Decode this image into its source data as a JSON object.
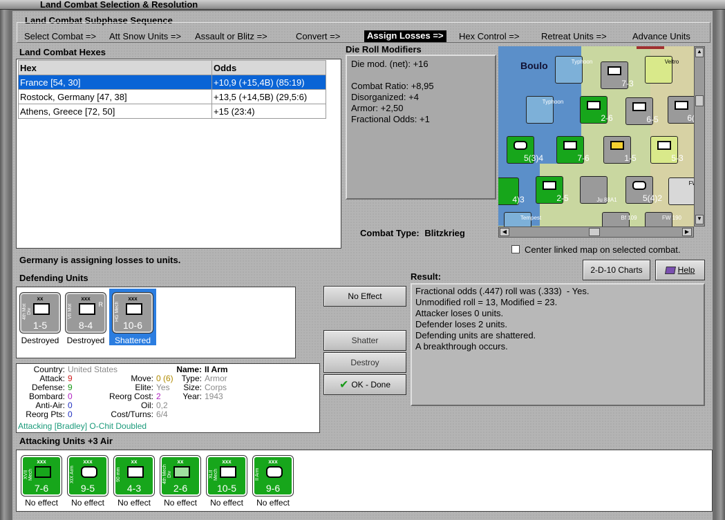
{
  "window": {
    "title": "Land Combat Selection & Resolution"
  },
  "subphase": {
    "heading": "Land Combat Subphase Sequence",
    "steps": [
      {
        "label": "Select Combat =>",
        "active": false
      },
      {
        "label": "Att Snow Units =>",
        "active": false
      },
      {
        "label": "Assault or Blitz =>",
        "active": false
      },
      {
        "label": "Convert =>",
        "active": false
      },
      {
        "label": "Assign Losses =>",
        "active": true
      },
      {
        "label": "Hex Control =>",
        "active": false
      },
      {
        "label": "Retreat Units =>",
        "active": false
      },
      {
        "label": "Advance Units",
        "active": false
      }
    ]
  },
  "hexes": {
    "heading": "Land Combat Hexes",
    "columns": [
      "Hex",
      "Odds"
    ],
    "rows": [
      {
        "hex": "France [54, 30]",
        "odds": "+10,9 (+15,4B) (85:19)",
        "selected": true
      },
      {
        "hex": "Rostock, Germany [47, 38]",
        "odds": "+13,5 (+14,5B) (29,5:6)",
        "selected": false
      },
      {
        "hex": "Athens, Greece [72, 50]",
        "odds": "+15 (23:4)",
        "selected": false
      }
    ]
  },
  "modifiers": {
    "heading": "Die Roll Modifiers",
    "lines": [
      "Die mod. (net): +16",
      "",
      "Combat Ratio: +8,95",
      "Disorganized: +4",
      "Armor: +2,50",
      "Fractional Odds: +1"
    ]
  },
  "combat_type": {
    "label": "Combat Type:",
    "value": "Blitzkrieg"
  },
  "center_map": {
    "label": "Center linked map on selected combat.",
    "checked": false
  },
  "status": "Germany is assigning losses to units.",
  "buttons": {
    "charts": "2-D-10 Charts",
    "help": "Help",
    "no_effect": "No Effect",
    "shatter": "Shatter",
    "destroy": "Destroy",
    "ok_done": "OK - Done"
  },
  "defending": {
    "heading": "Defending Units",
    "units": [
      {
        "side": "4th Mot Div",
        "size": "xx",
        "value": "1-5",
        "status": "Destroyed",
        "selected": false
      },
      {
        "side": "VII Mot",
        "size": "xxx",
        "value": "8-4",
        "status": "Destroyed",
        "selected": false,
        "flag": "R"
      },
      {
        "side": "HG Mech",
        "size": "xxx",
        "value": "10-6",
        "status": "Shattered",
        "selected": true
      }
    ]
  },
  "result": {
    "heading": "Result:",
    "lines": [
      "Fractional odds (.447) roll was (.333)  - Yes.",
      "Unmodified roll = 13, Modified = 23.",
      "Attacker loses 0 units.",
      "Defender loses 2 units.",
      "Defending units are shattered.",
      "A breakthrough occurs."
    ]
  },
  "unit_info": {
    "country_label": "Country:",
    "country": "United States",
    "attack_label": "Attack:",
    "attack": "9",
    "defense_label": "Defense:",
    "defense": "9",
    "bombard_label": "Bombard:",
    "bombard": "0",
    "antiair_label": "Anti-Air:",
    "antiair": "0",
    "reorgpts_label": "Reorg Pts:",
    "reorgpts": "0",
    "move_label": "Move:",
    "move": "0 (6)",
    "elite_label": "Elite:",
    "elite": "Yes",
    "reorgcost_label": "Reorg Cost:",
    "reorgcost": "2",
    "oil_label": "Oil:",
    "oil": "0,2",
    "costturns_label": "Cost/Turns:",
    "costturns": "6/4",
    "name_label": "Name:",
    "name": "II Arm",
    "type_label": "Type:",
    "type": "Armor",
    "size_label": "Size:",
    "size": "Corps",
    "year_label": "Year:",
    "year": "1943",
    "note": "Attacking [Bradley] O-Chit Doubled"
  },
  "attacking": {
    "heading": "Attacking Units +3 Air",
    "units": [
      {
        "side": "XVII Mech",
        "size": "xxx",
        "value": "7-6",
        "status": "No effect"
      },
      {
        "side": "XIX Arm",
        "size": "xxx",
        "value": "9-5",
        "status": "No effect"
      },
      {
        "side": "90 mm",
        "size": "xx",
        "value": "4-3",
        "status": "No effect"
      },
      {
        "side": "4th Mech Div",
        "size": "xx",
        "value": "2-6",
        "status": "No effect"
      },
      {
        "side": "XLII Mech",
        "size": "xxx",
        "value": "10-5",
        "status": "No effect"
      },
      {
        "side": "II Arm",
        "size": "xxx",
        "value": "9-6",
        "status": "No effect"
      }
    ]
  },
  "map_labels": {
    "town": "Boulo",
    "hex_values": [
      "7-3",
      "2-6",
      "6-5",
      "6(3)",
      "5(3)4",
      "7-6",
      "1-5",
      "5-3",
      "2-5",
      "5(4)2",
      "4)3"
    ],
    "aircraft": [
      "Typhoon",
      "Veltro",
      "Typhoon",
      "Ju 88A1",
      "Bf 109",
      "FW 190",
      "Tempest",
      "FW 1"
    ]
  },
  "colors": {
    "accent": "#0a64d6",
    "unit_green": "#17a61b",
    "selected_unit": "#2b7de0"
  }
}
